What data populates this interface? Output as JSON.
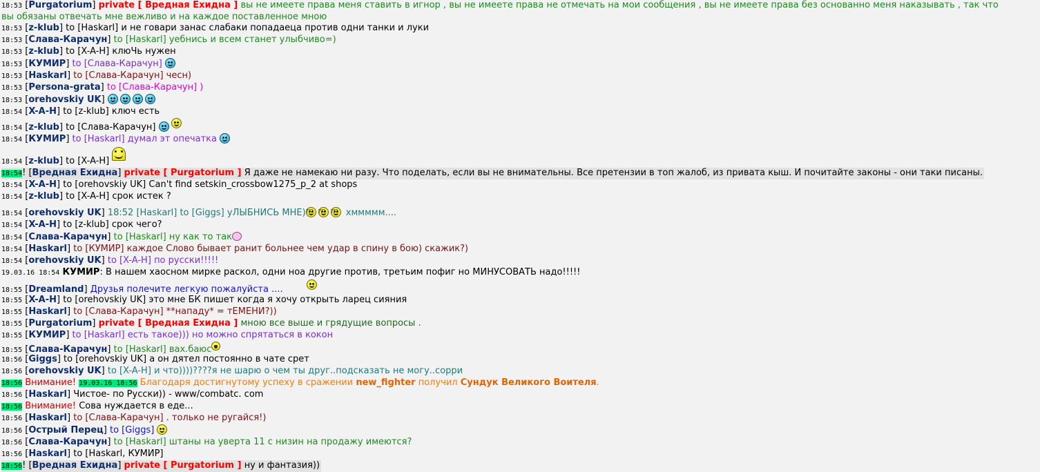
{
  "messages": [
    {
      "time": "18:53",
      "nick": "Purgatorium",
      "private": "private [ Вредная Ехидна ]",
      "text": "вы не имеете права меня ставить в игнор , вы не имеете права не отмечать на мои сообщения , вы не имеете права без основанно меня наказывать , так что вы обязаны отвечать мне вежливо и на каждое поставленное мною"
    },
    {
      "time": "18:53",
      "nick": "z-klub",
      "to": "to [Haskarl]",
      "text": "и не говари занас слабаки попадаеца против одни танки и луки"
    },
    {
      "time": "18:53",
      "nick": "Слава-Карачун",
      "to": "to [Haskarl]",
      "text": "уебнись и всем станет улыбчиво=)"
    },
    {
      "time": "18:53",
      "nick": "z-klub",
      "to": "to [X-A-H]",
      "text": "клюЧь нужен"
    },
    {
      "time": "18:53",
      "nick": "КУМИР",
      "to": "to [Слава-Карачун]",
      "text": ""
    },
    {
      "time": "18:53",
      "nick": "Haskarl",
      "to": "to [Слава-Карачун]",
      "text": "чесн)"
    },
    {
      "time": "18:53",
      "nick": "Persona-grata",
      "to": "to [Слава-Карачун] )",
      "text": ""
    },
    {
      "time": "18:53",
      "nick": "orehovskiy UK",
      "to": "",
      "text": ""
    },
    {
      "time": "18:54",
      "nick": "X-A-H",
      "to": "to [z-klub]",
      "text": "ключ есть"
    },
    {
      "time": "18:54",
      "nick": "z-klub",
      "to": "to [Слава-Карачун]",
      "text": ""
    },
    {
      "time": "18:54",
      "nick": "КУМИР",
      "to": "to [Haskarl]",
      "text": "думал эт опечатка"
    },
    {
      "time": "18:54",
      "nick": "z-klub",
      "to": "to [X-A-H]",
      "text": ""
    },
    {
      "time": "18:54",
      "nick": "Вредная Ехидна",
      "private": "private [ Purgatorium ]",
      "text": "Я даже не намекаю ни разу. Что поделать, если вы не внимательны. Все претензии в топ жалоб, из привата кыш. И почитайте законы - они таки писаны."
    },
    {
      "time": "18:54",
      "nick": "X-A-H",
      "to": "to [orehovskiy UK]",
      "text": "Can't find setskin_crossbow1275_p_2 at shops"
    },
    {
      "time": "18:54",
      "nick": "z-klub",
      "to": "to [X-A-H]",
      "text": "срок истек ?"
    },
    {
      "time": "18:54",
      "nick": "orehovskiy UK",
      "to": "18:52 [Haskarl] to [Giggs]",
      "text": "уЛЫБНИСЬ МНЕ)",
      "tail": "хммммм...."
    },
    {
      "time": "18:54",
      "nick": "X-A-H",
      "to": "to [z-klub]",
      "text": "срок чего?"
    },
    {
      "time": "18:54",
      "nick": "Слава-Карачун",
      "to": "to [Haskarl]",
      "text": "ну как то так"
    },
    {
      "time": "18:54",
      "nick": "Haskarl",
      "to": "to [КУМИР]",
      "text": "каждое Слово бывает ранит больнее чем удар в спину в бою) скажик?)"
    },
    {
      "time": "18:54",
      "nick": "orehovskiy UK",
      "to": "to [X-A-H]",
      "text": "по русски!!!!!"
    },
    {
      "time": "19.03.16 18:54",
      "nick": "КУМИР",
      "text": ": В нашем хаосном мирке раскол, одни ноа другие против, третьим пофиг но МИНУСОВАТЬ надо!!!!!"
    },
    {
      "time": "18:55",
      "nick": "Dreamland",
      "text": "Друзья полечите легкую пожалуйста ...."
    },
    {
      "time": "18:55",
      "nick": "X-A-H",
      "to": "to [orehovskiy UK]",
      "text": "это мне БК пишет когда я хочу открыть ларец сияния"
    },
    {
      "time": "18:55",
      "nick": "Haskarl",
      "to": "to [Слава-Карачун]",
      "text": "**нападу* = тЕМЕНИ?))"
    },
    {
      "time": "18:55",
      "nick": "Purgatorium",
      "private": "private [ Вредная Ехидна ]",
      "text": "мною все выше и грядущие вопросы ."
    },
    {
      "time": "18:55",
      "nick": "КУМИР",
      "to": "to [Haskarl]",
      "text": "есть такое))) но можно спрятаться в кокон"
    },
    {
      "time": "18:55",
      "nick": "Слава-Карачун",
      "to": "to [Haskarl]",
      "text": "вах.баюс"
    },
    {
      "time": "18:56",
      "nick": "Giggs",
      "to": "to [orehovskiy UK]",
      "text": "а он дятел постоянно в чате срет"
    },
    {
      "time": "18:56",
      "nick": "orehovskiy UK",
      "to": "to [X-A-H]",
      "text": "и что))))????я не шарю о чем ты друг..подсказать не могу..сорри"
    },
    {
      "time": "18:56",
      "system": "Внимание!",
      "stamp": "19.03.16 18:56",
      "text": "Благодаря достигнутому успеху в сражении",
      "who": "new_fighter",
      "mid": "получил",
      "prize": "Сундук Великого Воителя",
      "end": "."
    },
    {
      "time": "18:56",
      "nick": "Haskarl",
      "text": "Чистое- по Русски)) - www/combatc. com"
    },
    {
      "time": "18:56",
      "system": "Внимание!",
      "text": "Сова нуждается в еде..."
    },
    {
      "time": "18:56",
      "nick": "Haskarl",
      "to": "to [Слава-Карачун]",
      "text": ". только не ругайся!)"
    },
    {
      "time": "18:56",
      "nick": "Острый Перец",
      "to": "to [Giggs]",
      "text": ""
    },
    {
      "time": "18:56",
      "nick": "Слава-Карачун",
      "to": "to [Haskarl]",
      "text": "штаны на уверта 11 с низин на продажу имеются?"
    },
    {
      "time": "18:56",
      "nick": "Haskarl",
      "to": "to [Haskarl, КУМИР]",
      "text": ""
    },
    {
      "time": "18:56",
      "nick": "Вредная Ехидна",
      "private": "private [ Purgatorium ]",
      "text": "ну и фантазия))"
    }
  ],
  "colors": {
    "background": "#f2f2f2",
    "highlight": "#00e67a",
    "nick": "#0d2d6c",
    "private": "#ff0000"
  }
}
